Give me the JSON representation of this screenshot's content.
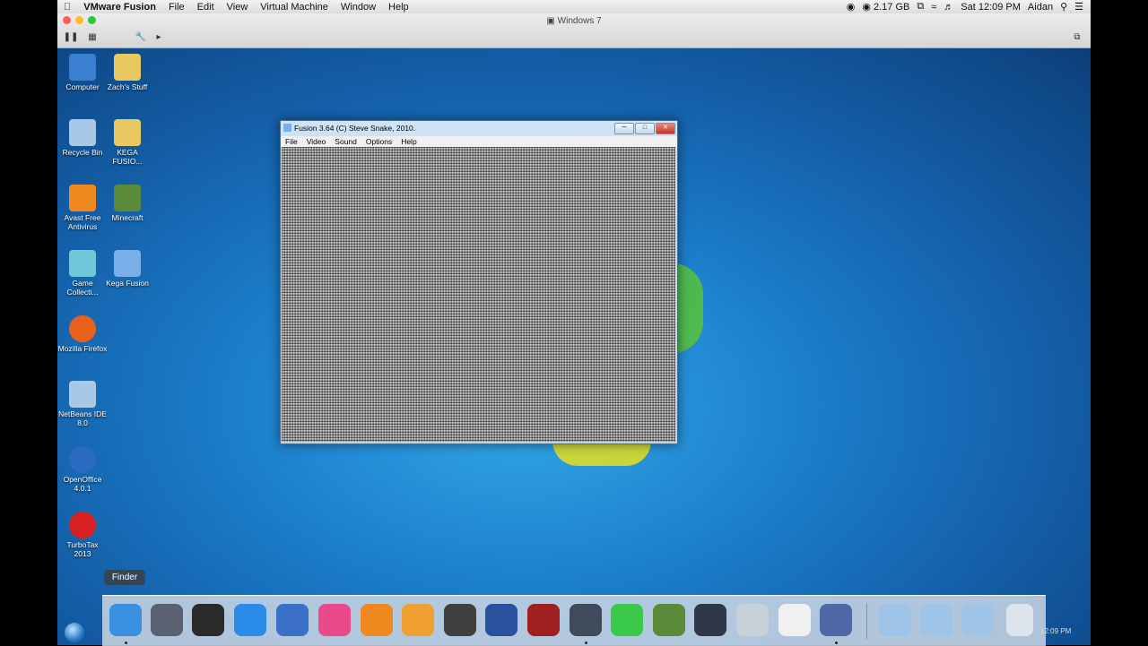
{
  "menubar": {
    "app": "VMware Fusion",
    "items": [
      "File",
      "Edit",
      "View",
      "Virtual Machine",
      "Window",
      "Help"
    ],
    "memory": "2.17 GB",
    "clock": "Sat 12:09 PM",
    "user": "Aidan"
  },
  "vm": {
    "title": "Windows 7"
  },
  "desktop_icons": [
    {
      "label": "Computer",
      "color": "#3a7fd0"
    },
    {
      "label": "Zach's Stuff",
      "color": "#e8c860"
    },
    {
      "label": "Recycle Bin",
      "color": "#a9c7e6"
    },
    {
      "label": "KEGA FUSIO...",
      "color": "#e8c860"
    },
    {
      "label": "Avast Free Antivirus",
      "color": "#f08a20"
    },
    {
      "label": "Minecraft",
      "color": "#5a8a3a"
    },
    {
      "label": "Game Collecti...",
      "color": "#6ec8d8"
    },
    {
      "label": "Kega Fusion",
      "color": "#7ab0e8"
    },
    {
      "label": "Mozilla Firefox",
      "color": "#e8621e"
    },
    {
      "label": "NetBeans IDE 8.0",
      "color": "#a8c8e8"
    },
    {
      "label": "OpenOffice 4.0.1",
      "color": "#2a6ac0"
    },
    {
      "label": "TurboTax 2013",
      "color": "#d82020"
    }
  ],
  "fusion_window": {
    "title": "Fusion 3.64 (C) Steve Snake, 2010.",
    "menu": [
      "File",
      "Video",
      "Sound",
      "Options",
      "Help"
    ]
  },
  "dock": {
    "tooltip": "Finder",
    "items": [
      {
        "name": "finder-icon",
        "color": "#3b8fe0"
      },
      {
        "name": "launchpad-icon",
        "color": "#5a6070"
      },
      {
        "name": "mission-control-icon",
        "color": "#2a2a2a"
      },
      {
        "name": "safari-icon",
        "color": "#2a8ce8"
      },
      {
        "name": "openoffice-icon",
        "color": "#3a70c8"
      },
      {
        "name": "itunes-icon",
        "color": "#e84a8a"
      },
      {
        "name": "ibooks-icon",
        "color": "#f08a20"
      },
      {
        "name": "photos-icon",
        "color": "#f0a030"
      },
      {
        "name": "imovie-icon",
        "color": "#404040"
      },
      {
        "name": "vectorworks-icon",
        "color": "#2a50a0"
      },
      {
        "name": "photo-booth-icon",
        "color": "#a02020"
      },
      {
        "name": "quicktime-icon",
        "color": "#404a5a"
      },
      {
        "name": "facetime-icon",
        "color": "#3ac84a"
      },
      {
        "name": "minecraft-icon",
        "color": "#5a8a3a"
      },
      {
        "name": "dvd-player-icon",
        "color": "#303848"
      },
      {
        "name": "preview-icon",
        "color": "#c8d0d8"
      },
      {
        "name": "textedit-icon",
        "color": "#f0f0f0"
      },
      {
        "name": "vmware-fusion-icon",
        "color": "#5068a8"
      },
      {
        "name": "applications-folder-icon",
        "color": "#9ec4e8"
      },
      {
        "name": "documents-folder-icon",
        "color": "#9ec4e8"
      },
      {
        "name": "downloads-folder-icon",
        "color": "#9ec4e8"
      },
      {
        "name": "trash-icon",
        "color": "#dde4ec"
      }
    ]
  },
  "taskbar": {
    "clock": "12:09 PM"
  }
}
